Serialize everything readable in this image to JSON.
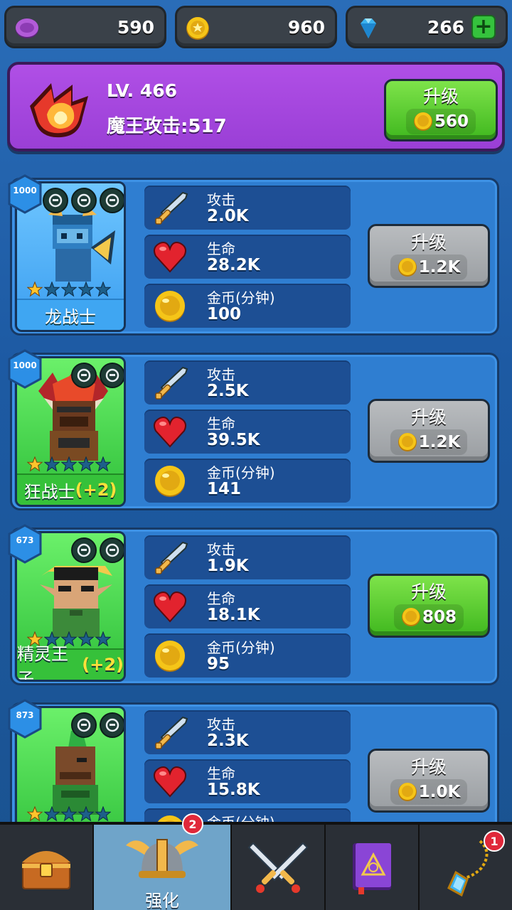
{
  "resources": [
    {
      "icon": "purple-token-icon",
      "value": "590"
    },
    {
      "icon": "gold-coin-icon",
      "value": "960"
    },
    {
      "icon": "blue-gem-icon",
      "value": "266"
    }
  ],
  "boss": {
    "level": "LV. 466",
    "attack": "魔王攻击:517",
    "upgrade_label": "升级",
    "upgrade_cost": "560"
  },
  "stat_labels": {
    "attack": "攻击",
    "health": "生命",
    "gold": "金币(分钟)"
  },
  "heroes": [
    {
      "power": "1000",
      "name": "龙战士",
      "bonus": "",
      "stars": 1,
      "attack": "2.0K",
      "health": "28.2K",
      "gold": "100",
      "upgrade_label": "升级",
      "cost": "1.2K",
      "affordable": false
    },
    {
      "power": "1000",
      "name": "狂战士",
      "bonus": "(+2)",
      "stars": 1,
      "attack": "2.5K",
      "health": "39.5K",
      "gold": "141",
      "upgrade_label": "升级",
      "cost": "1.2K",
      "affordable": false
    },
    {
      "power": "673",
      "name": "精灵王子",
      "bonus": "(+2)",
      "stars": 1,
      "attack": "1.9K",
      "health": "18.1K",
      "gold": "95",
      "upgrade_label": "升级",
      "cost": "808",
      "affordable": true
    },
    {
      "power": "873",
      "name": "",
      "bonus": "",
      "stars": 1,
      "attack": "2.3K",
      "health": "15.8K",
      "gold": "",
      "upgrade_label": "升级",
      "cost": "1.0K",
      "affordable": false
    }
  ],
  "nav": {
    "items": [
      {
        "icon": "treasure-chest-icon",
        "label": "",
        "badge": ""
      },
      {
        "icon": "viking-helmet-icon",
        "label": "强化",
        "badge": "2"
      },
      {
        "icon": "crossed-swords-icon",
        "label": "",
        "badge": ""
      },
      {
        "icon": "spellbook-icon",
        "label": "",
        "badge": ""
      },
      {
        "icon": "amulet-icon",
        "label": "",
        "badge": "1"
      }
    ],
    "active_index": 1
  },
  "colors": {
    "background": "#1e5fa8",
    "boss_panel": "#a947e0",
    "button_green": "#40b81f",
    "button_gray": "#9a9ea2",
    "coin": "#f5c518",
    "badge_red": "#e0283a"
  }
}
